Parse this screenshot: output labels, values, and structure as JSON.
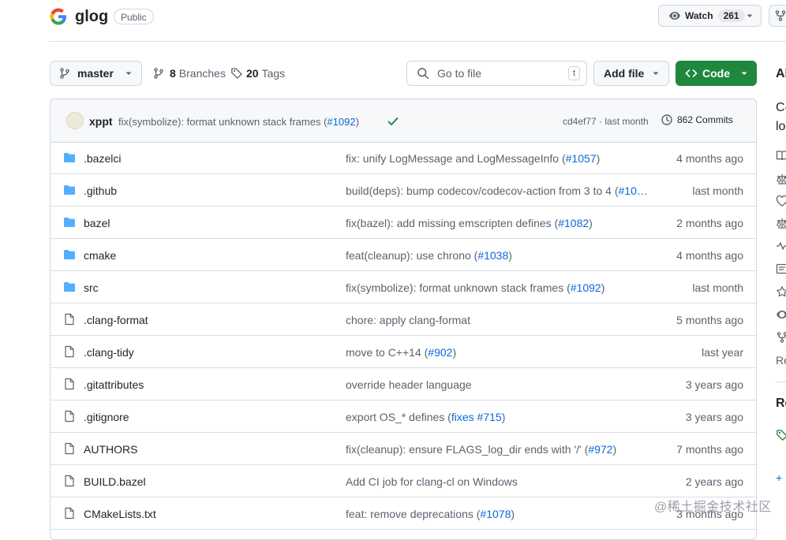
{
  "repo": {
    "name": "glog",
    "visibility": "Public"
  },
  "header": {
    "watch_label": "Watch",
    "watch_count": "261"
  },
  "toolbar": {
    "branch": "master",
    "branches_count": "8",
    "branches_label": "Branches",
    "tags_count": "20",
    "tags_label": "Tags",
    "search_placeholder": "Go to file",
    "search_shortcut": "t",
    "add_file_label": "Add file",
    "code_label": "Code"
  },
  "latest_commit": {
    "author": "xppt",
    "message": "fix(symbolize): format unknown stack frames (",
    "pr": "#1092",
    "message_end": ")",
    "sha_and_time": "cd4ef77 · last month",
    "commits_count": "862 Commits"
  },
  "files": [
    {
      "type": "folder",
      "name": ".bazelci",
      "msg": "fix: unify LogMessage and LogMessageInfo (",
      "pr": "#1057",
      "end": ")",
      "age": "4 months ago"
    },
    {
      "type": "folder",
      "name": ".github",
      "msg": "build(deps): bump codecov/codecov-action from 3 to 4 (",
      "pr": "#10…",
      "end": "",
      "age": "last month"
    },
    {
      "type": "folder",
      "name": "bazel",
      "msg": "fix(bazel): add missing emscripten defines (",
      "pr": "#1082",
      "end": ")",
      "age": "2 months ago"
    },
    {
      "type": "folder",
      "name": "cmake",
      "msg": "feat(cleanup): use chrono (",
      "pr": "#1038",
      "end": ")",
      "age": "4 months ago"
    },
    {
      "type": "folder",
      "name": "src",
      "msg": "fix(symbolize): format unknown stack frames (",
      "pr": "#1092",
      "end": ")",
      "age": "last month"
    },
    {
      "type": "file",
      "name": ".clang-format",
      "msg": "chore: apply clang-format",
      "pr": "",
      "end": "",
      "age": "5 months ago"
    },
    {
      "type": "file",
      "name": ".clang-tidy",
      "msg": "move to C++14 (",
      "pr": "#902",
      "end": ")",
      "age": "last year"
    },
    {
      "type": "file",
      "name": ".gitattributes",
      "msg": "override header language",
      "pr": "",
      "end": "",
      "age": "3 years ago"
    },
    {
      "type": "file",
      "name": ".gitignore",
      "msg": "export OS_* defines (",
      "pr": "fixes #715",
      "end": ")",
      "age": "3 years ago"
    },
    {
      "type": "file",
      "name": "AUTHORS",
      "msg": "fix(cleanup): ensure FLAGS_log_dir ends with '/' (",
      "pr": "#972",
      "end": ")",
      "age": "7 months ago"
    },
    {
      "type": "file",
      "name": "BUILD.bazel",
      "msg": "Add CI job for clang-cl on Windows",
      "pr": "",
      "end": "",
      "age": "2 years ago"
    },
    {
      "type": "file",
      "name": "CMakeLists.txt",
      "msg": "feat: remove deprecations (",
      "pr": "#1078",
      "end": ")",
      "age": "3 months ago"
    }
  ],
  "sidebar": {
    "about_heading": "Al",
    "desc_line1": "C-",
    "desc_line2": "lo",
    "re_label": "Re",
    "releases_heading": "Re",
    "plus": "+"
  },
  "watermark": "@稀土掘金技术社区",
  "colors": {
    "accent_blue": "#0969da",
    "folder_blue": "#54aeff",
    "code_green": "#1f883d",
    "check_green": "#1a7f37"
  }
}
